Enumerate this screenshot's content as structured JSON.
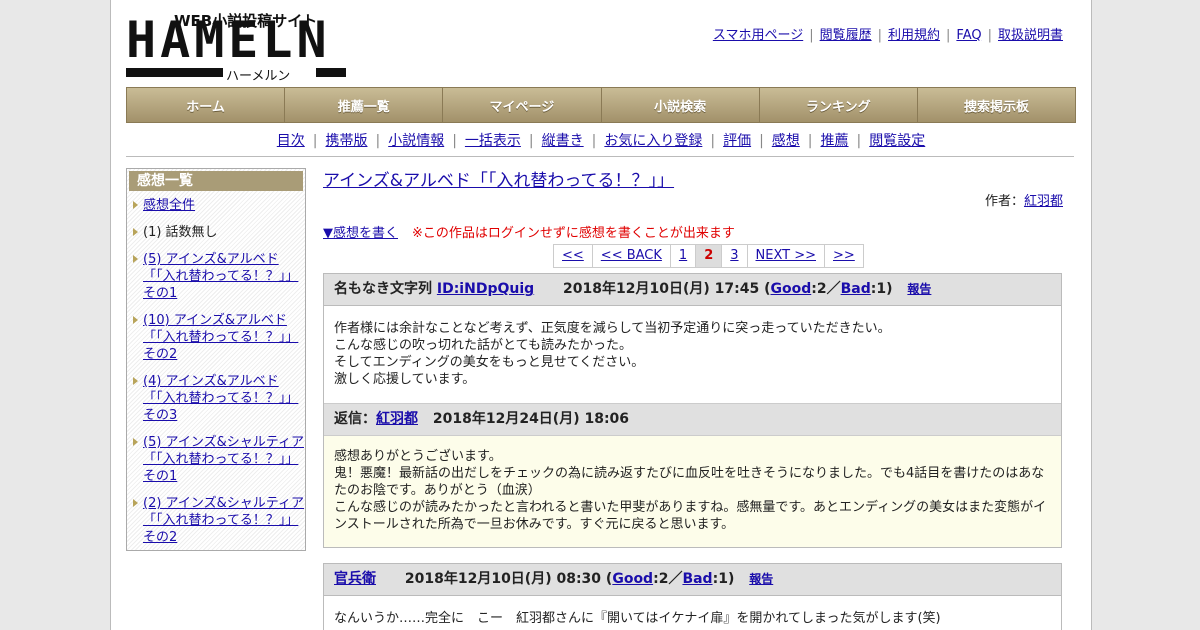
{
  "header": {
    "logo_main": "HAMELN",
    "logo_tag": "WEB小説投稿サイト",
    "logo_kana": "ハーメルン",
    "top_links": [
      "スマホ用ページ",
      "閲覧履歴",
      "利用規約",
      "FAQ",
      "取扱説明書"
    ]
  },
  "main_nav": [
    "ホーム",
    "推薦一覧",
    "マイページ",
    "小説検索",
    "ランキング",
    "捜索掲示板"
  ],
  "sub_nav": [
    "目次",
    "携帯版",
    "小説情報",
    "一括表示",
    "縦書き",
    "お気に入り登録",
    "評価",
    "感想",
    "推薦",
    "閲覧設定"
  ],
  "sidebar": {
    "title": "感想一覧",
    "items": [
      {
        "label": "感想全件",
        "link": true
      },
      {
        "label": "(1) 話数無し",
        "link": false
      },
      {
        "label": "(5) アインズ&アルベド「「入れ替わってる！？」」その1",
        "link": true
      },
      {
        "label": "(10) アインズ&アルベド「「入れ替わってる！？」」その2",
        "link": true
      },
      {
        "label": "(4) アインズ&アルベド「「入れ替わってる！？」」その3",
        "link": true
      },
      {
        "label": "(5) アインズ&シャルティア「「入れ替わってる！？」」その1",
        "link": true
      },
      {
        "label": "(2) アインズ&シャルティア「「入れ替わってる！？」」その2",
        "link": true
      }
    ]
  },
  "work": {
    "title": "アインズ&アルベド「「入れ替わってる！？」」",
    "author_label": "作者：",
    "author": "紅羽都"
  },
  "write_link": "▼感想を書く",
  "login_warning": "※この作品はログインせずに感想を書くことが出来ます",
  "pager": [
    "<<",
    "<< BACK",
    "1",
    "2",
    "3",
    "NEXT >>",
    ">>"
  ],
  "pager_current": "2",
  "reviews": [
    {
      "name": "名もなき文字列",
      "id": "ID:iNDpQuig",
      "date": "2018年12月10日(月) 17:45",
      "good_label": "Good",
      "good": "2",
      "bad_label": "Bad",
      "bad": "1",
      "report": "報告",
      "body": [
        "作者様には余計なことなど考えず、正気度を減らして当初予定通りに突っ走っていただきたい。",
        "こんな感じの吹っ切れた話がとても読みたかった。",
        "そしてエンディングの美女をもっと見せてください。",
        "激しく応援しています。"
      ],
      "reply": {
        "label": "返信：",
        "name": "紅羽都",
        "date": "2018年12月24日(月) 18:06",
        "body": [
          "感想ありがとうございます。",
          "鬼！悪魔！最新話の出だしをチェックの為に読み返すたびに血反吐を吐きそうになりました。でも4話目を書けたのはあなたのお陰です。ありがとう（血涙）",
          "こんな感じのが読みたかったと言われると書いた甲斐がありますね。感無量です。あとエンディングの美女はまた変態がインストールされた所為で一旦お休みです。すぐ元に戻ると思います。"
        ]
      }
    },
    {
      "name": "官兵衛",
      "date": "2018年12月10日(月) 08:30",
      "good_label": "Good",
      "good": "2",
      "bad_label": "Bad",
      "bad": "1",
      "report": "報告",
      "body": [
        "なんいうか……完全に　こー　紅羽都さんに『開いてはイケナイ扉』を開かれてしまった気がします(笑)"
      ]
    }
  ]
}
